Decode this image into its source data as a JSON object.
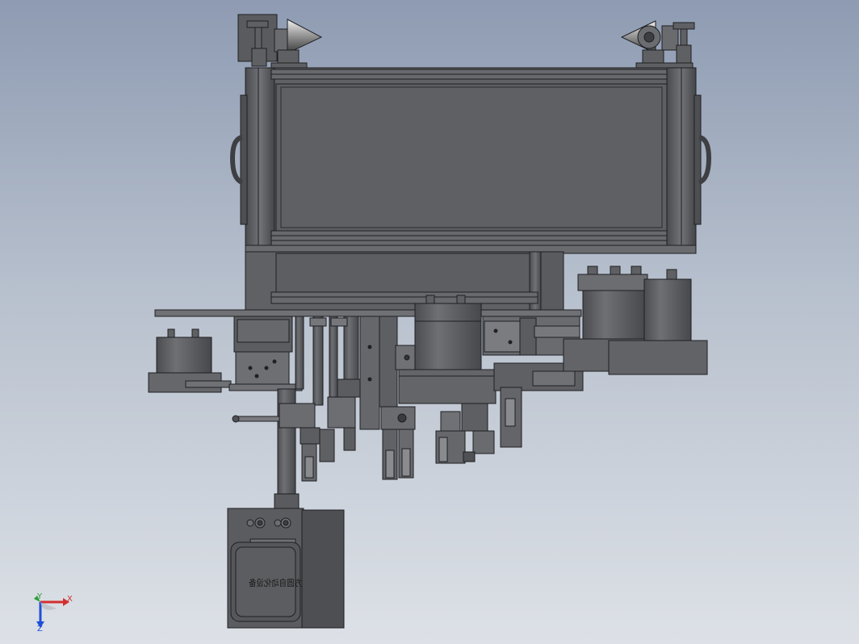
{
  "viewport": {
    "background_top": "#8e9bb2",
    "background_bottom": "#dde1e7",
    "model_color": "#5f6063",
    "edge_color": "#1e1f22"
  },
  "triad": {
    "x_label": "X",
    "y_label": "Y",
    "z_label": "Z",
    "x_color": "#d32f2f",
    "y_color": "#2e9d3a",
    "z_color": "#1f4fd6"
  },
  "cabinet": {
    "nameplate_text": "方圆自动化设备"
  }
}
